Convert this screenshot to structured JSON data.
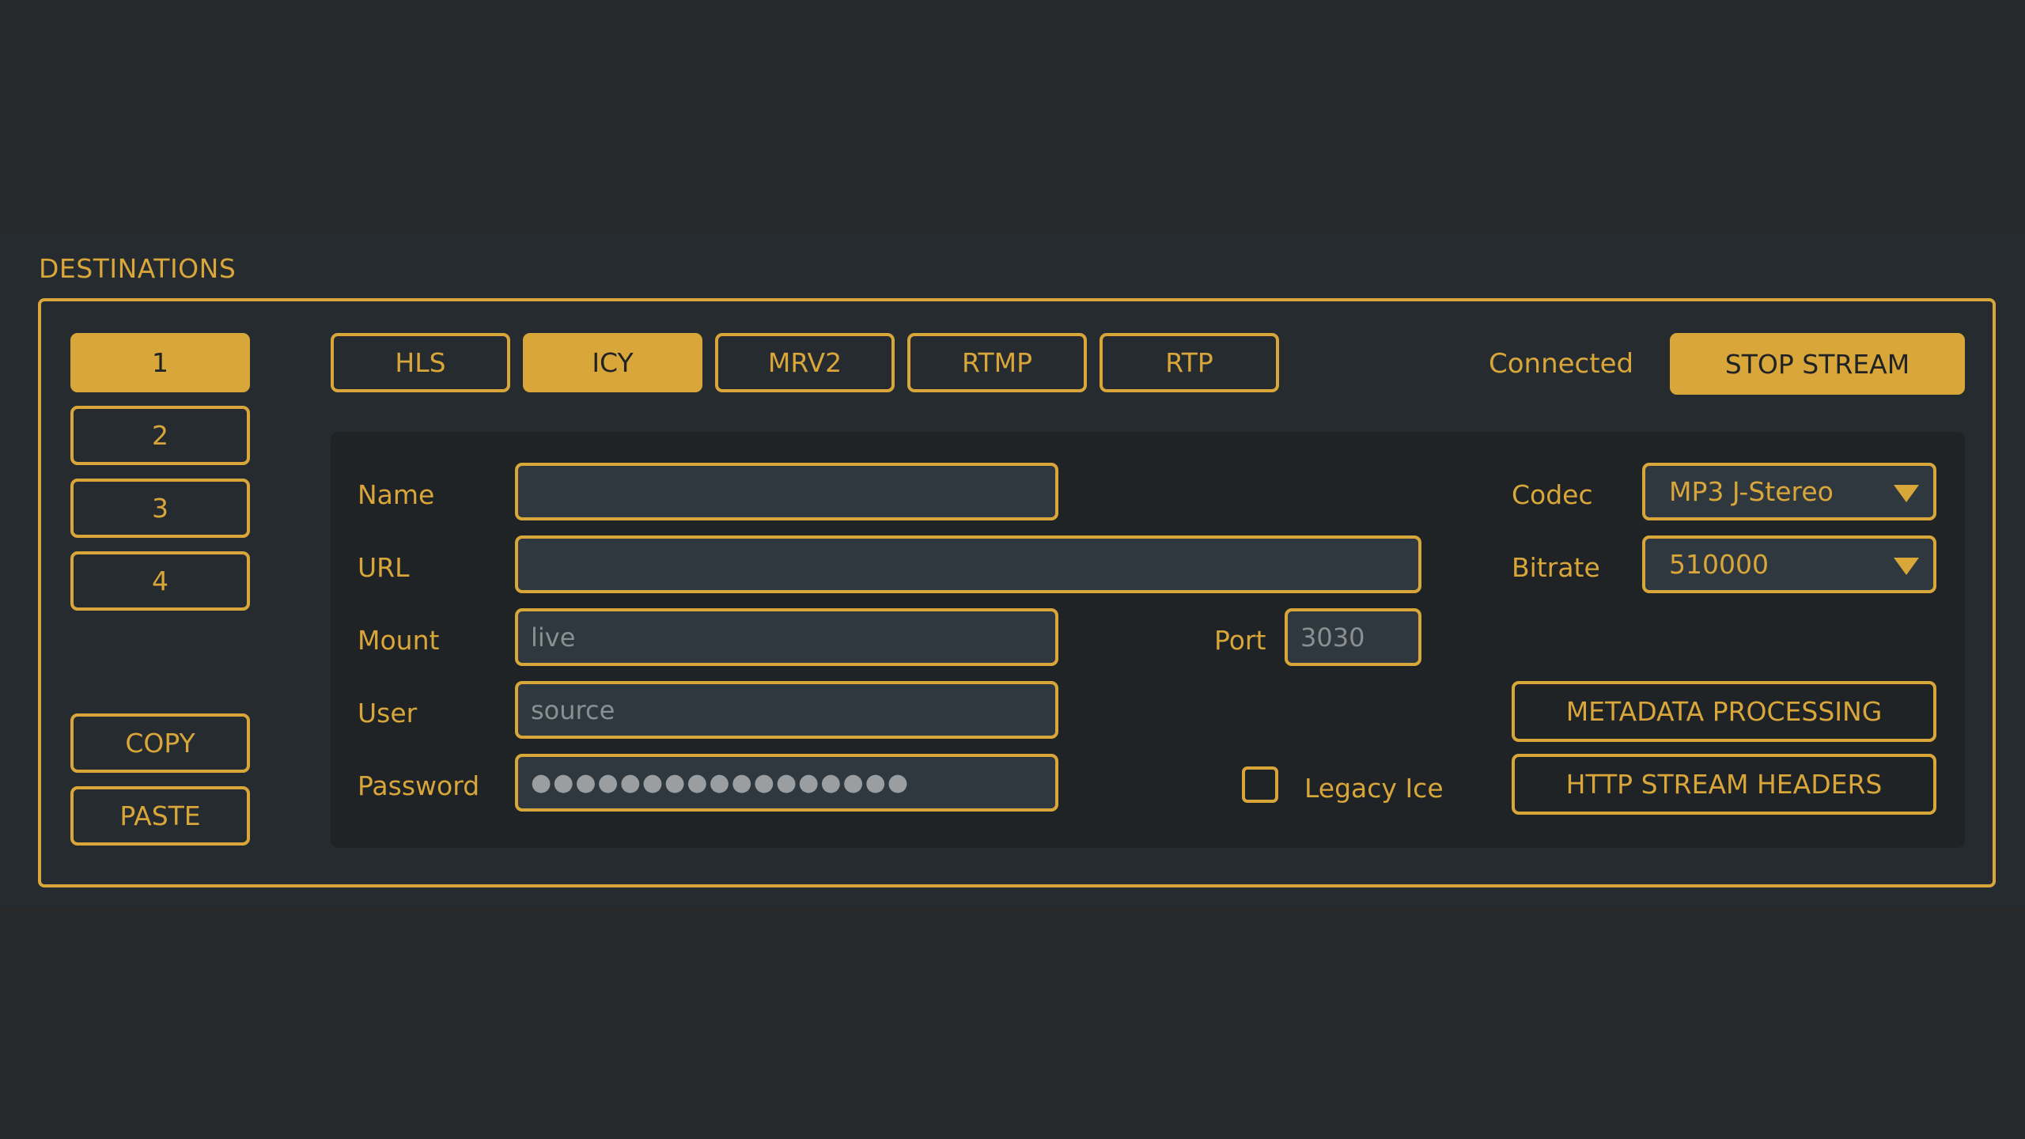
{
  "section_title": "DESTINATIONS",
  "destinations": [
    "1",
    "2",
    "3",
    "4"
  ],
  "active_destination": "1",
  "clipboard": {
    "copy_label": "COPY",
    "paste_label": "PASTE"
  },
  "protocols": [
    "HLS",
    "ICY",
    "MRV2",
    "RTMP",
    "RTP"
  ],
  "active_protocol": "ICY",
  "status_text": "Connected",
  "stop_stream_label": "STOP STREAM",
  "form": {
    "name_label": "Name",
    "name_value": "",
    "url_label": "URL",
    "url_value": "",
    "mount_label": "Mount",
    "mount_placeholder": "live",
    "user_label": "User",
    "user_placeholder": "source",
    "password_label": "Password",
    "password_value": "●●●●●●●●●●●●●●●●●",
    "port_label": "Port",
    "port_placeholder": "3030",
    "legacy_ice_label": "Legacy Ice",
    "legacy_ice_checked": false
  },
  "codec": {
    "label": "Codec",
    "value": "MP3 J-Stereo"
  },
  "bitrate": {
    "label": "Bitrate",
    "value": "510000"
  },
  "actions": {
    "metadata_label": "METADATA PROCESSING",
    "headers_label": "HTTP STREAM HEADERS"
  },
  "colors": {
    "accent": "#d9a63a",
    "background": "#27292b",
    "panel_inner": "#1f2326",
    "field": "#2f383e"
  }
}
